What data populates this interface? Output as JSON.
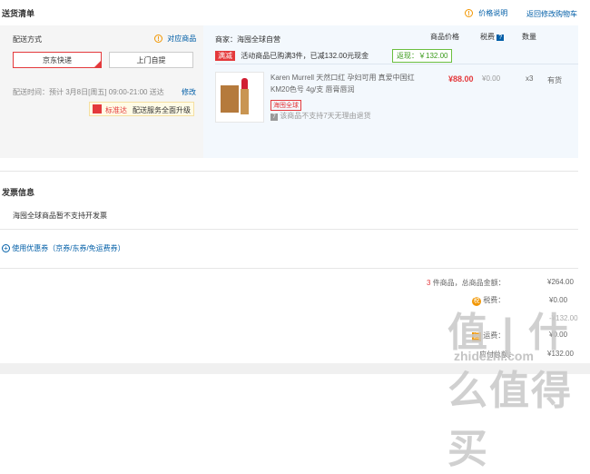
{
  "header": {
    "title": "送货清单",
    "price_note": "价格说明",
    "back_to_cart": "返回修改购物车"
  },
  "delivery": {
    "label": "配送方式",
    "match_goods": "对应商品",
    "option_jd": "京东快递",
    "option_pickup": "上门自提",
    "time_label": "配送时间：预计 3月8日[周五] 09:00-21:00 送达",
    "edit": "修改",
    "standard_tag": "标准达",
    "standard_desc": "配送服务全面升级"
  },
  "shop": {
    "label": "商家：海囤全球自营",
    "col_price": "商品价格",
    "col_tax": "税费",
    "tax_q": "?",
    "col_qty": "数量"
  },
  "promo": {
    "tag": "满减",
    "text": "活动商品已购满3件，已减132.00元现金",
    "rebate": "返现：￥132.00"
  },
  "item": {
    "name_line1": "Karen Murrell 天然口红 孕妇可用 真爱中国红",
    "name_line2": "KM20色号 4g/支 唇膏唇润",
    "hk_tag": "海囤全球",
    "no_return": "该商品不支持7天无理由退货",
    "price": "¥88.00",
    "tax": "¥0.00",
    "qty": "x3",
    "stock": "有货"
  },
  "invoice": {
    "title": "发票信息",
    "note": "海囤全球商品暂不支持开发票"
  },
  "coupon": {
    "text": "使用优惠券（京券/东券/免运费券）"
  },
  "summary": {
    "count": "3",
    "count_label": "件商品，总商品金额：",
    "total": "¥264.00",
    "tax_label": "税费：",
    "tax_value": "¥0.00",
    "row2_value": "-¥132.00",
    "row3_label": "运费：",
    "row3_value": "¥0.00",
    "pay_label": "应付总额：",
    "pay_value": "¥132.00"
  },
  "watermark": {
    "big": "值 | 什么值得买",
    "url": "zhidezhi.com"
  }
}
